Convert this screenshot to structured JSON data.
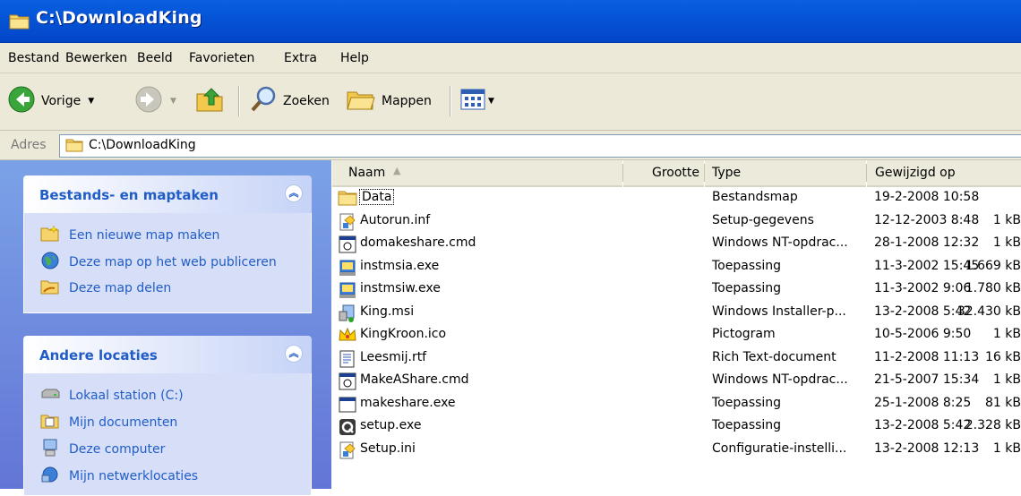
{
  "window": {
    "title": "C:\\DownloadKing"
  },
  "menu": [
    "Bestand",
    "Bewerken",
    "Beeld",
    "Favorieten",
    "Extra",
    "Help"
  ],
  "toolbar": {
    "back_label": "Vorige",
    "search_label": "Zoeken",
    "folders_label": "Mappen"
  },
  "address": {
    "label": "Adres",
    "value": "C:\\DownloadKing"
  },
  "tasks_panel": {
    "title": "Bestands- en maptaken",
    "items": [
      "Een nieuwe map maken",
      "Deze map op het web publiceren",
      "Deze map delen"
    ]
  },
  "locations_panel": {
    "title": "Andere locaties",
    "items": [
      "Lokaal station (C:)",
      "Mijn documenten",
      "Deze computer",
      "Mijn netwerklocaties"
    ]
  },
  "columns": {
    "name": "Naam",
    "size": "Grootte",
    "type": "Type",
    "modified": "Gewijzigd op"
  },
  "files": [
    {
      "name": "Data",
      "size": "",
      "type": "Bestandsmap",
      "modified": "19-2-2008 10:58",
      "icon": "folder-icon"
    },
    {
      "name": "Autorun.inf",
      "size": "1 kB",
      "type": "Setup-gegevens",
      "modified": "12-12-2003 8:48",
      "icon": "setup-info-icon"
    },
    {
      "name": "domakeshare.cmd",
      "size": "1 kB",
      "type": "Windows NT-opdrac...",
      "modified": "28-1-2008 12:32",
      "icon": "cmd-icon"
    },
    {
      "name": "instmsia.exe",
      "size": "1.669 kB",
      "type": "Toepassing",
      "modified": "11-3-2002 15:45",
      "icon": "installer-exe-icon"
    },
    {
      "name": "instmsiw.exe",
      "size": "1.780 kB",
      "type": "Toepassing",
      "modified": "11-3-2002 9:06",
      "icon": "installer-exe-icon"
    },
    {
      "name": "King.msi",
      "size": "32.430 kB",
      "type": "Windows Installer-p...",
      "modified": "13-2-2008 5:42",
      "icon": "msi-icon"
    },
    {
      "name": "KingKroon.ico",
      "size": "1 kB",
      "type": "Pictogram",
      "modified": "10-5-2006 9:50",
      "icon": "crown-icon"
    },
    {
      "name": "Leesmij.rtf",
      "size": "16 kB",
      "type": "Rich Text-document",
      "modified": "11-2-2008 11:13",
      "icon": "rtf-icon"
    },
    {
      "name": "MakeAShare.cmd",
      "size": "1 kB",
      "type": "Windows NT-opdrac...",
      "modified": "21-5-2007 15:34",
      "icon": "cmd-icon"
    },
    {
      "name": "makeshare.exe",
      "size": "81 kB",
      "type": "Toepassing",
      "modified": "25-1-2008 8:25",
      "icon": "exe-window-icon"
    },
    {
      "name": "setup.exe",
      "size": "2.328 kB",
      "type": "Toepassing",
      "modified": "13-2-2008 5:42",
      "icon": "setup-exe-icon"
    },
    {
      "name": "Setup.ini",
      "size": "1 kB",
      "type": "Configuratie-instelli...",
      "modified": "13-2-2008 12:13",
      "icon": "setup-info-icon"
    }
  ]
}
